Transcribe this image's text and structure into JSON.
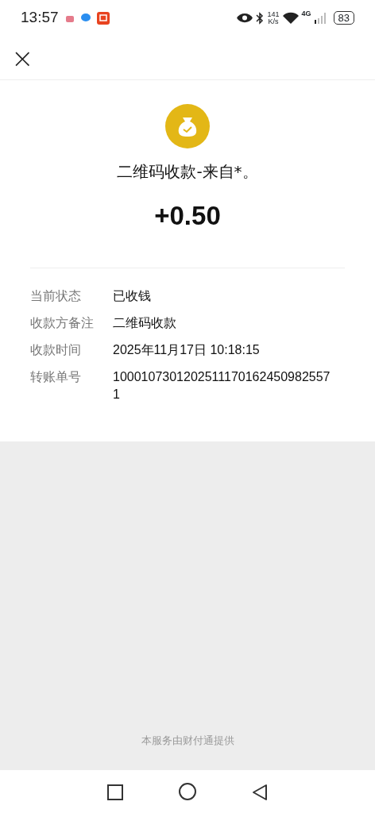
{
  "status_bar": {
    "time": "13:57",
    "network_speed": "141",
    "network_speed_unit": "K/s",
    "network_type": "4G",
    "battery": "83"
  },
  "header": {
    "close": "×"
  },
  "payment": {
    "title": "二维码收款-来自*。",
    "amount": "+0.50"
  },
  "details": [
    {
      "label": "当前状态",
      "value": "已收钱"
    },
    {
      "label": "收款方备注",
      "value": "二维码收款"
    },
    {
      "label": "收款时间",
      "value": "2025年11月17日 10:18:15"
    },
    {
      "label": "转账单号",
      "value": "10001073012025111701624509825571"
    }
  ],
  "footer": "本服务由财付通提供"
}
